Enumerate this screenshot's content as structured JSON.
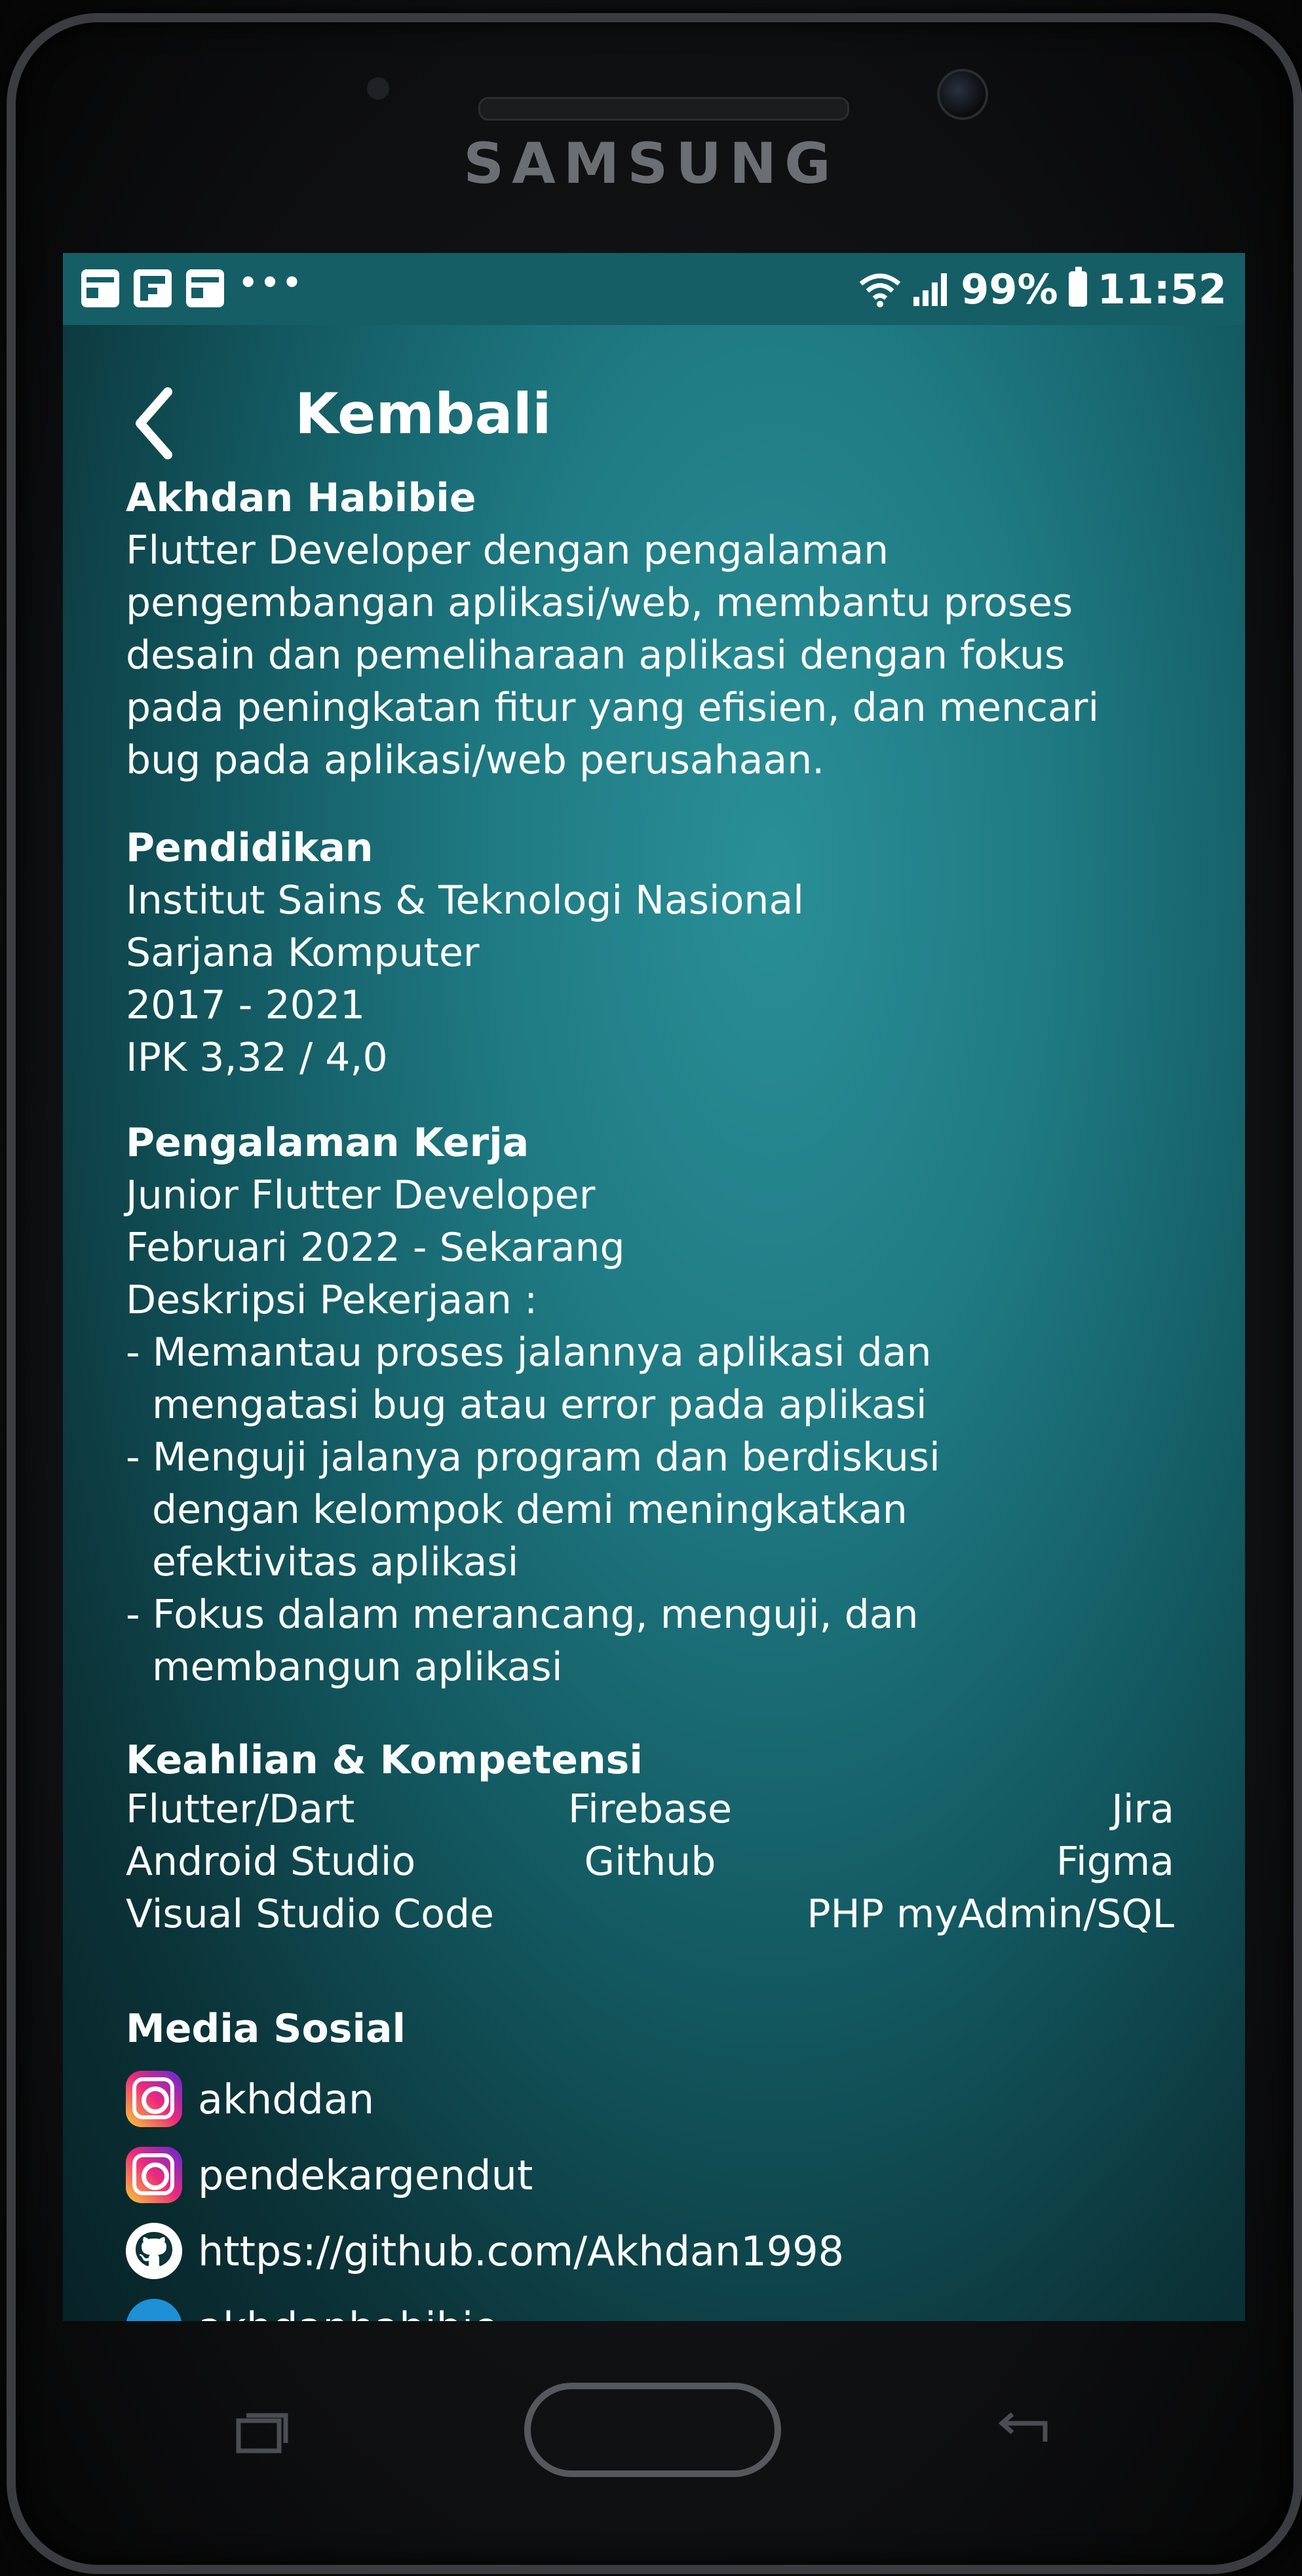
{
  "device": {
    "brand": "SAMSUNG"
  },
  "status_bar": {
    "battery": "99%",
    "time": "11:52",
    "notification_icons": [
      "flipboard-icon",
      "news-icon",
      "news-icon"
    ],
    "more": "•••"
  },
  "header": {
    "back_label": "Kembali"
  },
  "profile": {
    "name": "Akhdan Habibie",
    "summary_lines": [
      "Flutter Developer dengan pengalaman",
      "pengembangan aplikasi/web, membantu proses",
      "desain dan pemeliharaan aplikasi dengan fokus",
      "pada peningkatan fitur yang efisien, dan mencari",
      "bug pada aplikasi/web perusahaan."
    ]
  },
  "education": {
    "heading": "Pendidikan",
    "institution": "Institut Sains & Teknologi Nasional",
    "degree": "Sarjana Komputer",
    "years": "2017 - 2021",
    "gpa": "IPK 3,32 / 4,0"
  },
  "experience": {
    "heading": "Pengalaman Kerja",
    "role": "Junior Flutter Developer",
    "period": "Februari 2022 - Sekarang",
    "desc_label": "Deskripsi Pekerjaan :",
    "bullets": [
      [
        "- Memantau proses jalannya aplikasi dan",
        "mengatasi bug atau error pada aplikasi"
      ],
      [
        "- Menguji jalanya program dan berdiskusi",
        "dengan kelompok demi meningkatkan",
        "efektivitas aplikasi"
      ],
      [
        "- Fokus dalam merancang, menguji, dan",
        "membangun aplikasi"
      ]
    ]
  },
  "skills": {
    "heading": "Keahlian & Kompetensi",
    "rows": [
      [
        "Flutter/Dart",
        "Firebase",
        "Jira"
      ],
      [
        "Android Studio",
        "Github",
        "Figma"
      ],
      [
        "Visual Studio Code",
        "",
        "PHP myAdmin/SQL"
      ]
    ]
  },
  "social": {
    "heading": "Media Sosial",
    "items": [
      {
        "icon": "instagram-icon",
        "label": "akhddan"
      },
      {
        "icon": "instagram-icon",
        "label": "pendekargendut"
      },
      {
        "icon": "github-icon",
        "label": "https://github.com/Akhdan1998"
      },
      {
        "icon": "linkedin-icon",
        "label": "akhdanhabibie"
      }
    ]
  }
}
